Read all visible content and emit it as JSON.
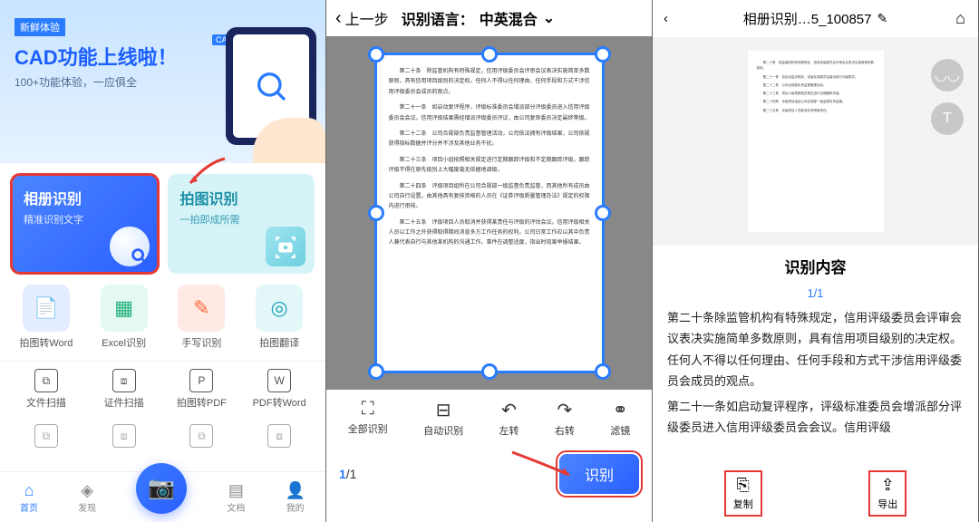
{
  "panel1": {
    "badge": "新鲜体验",
    "bannerTitle": "CAD功能上线啦！",
    "bannerSub": "100+功能体验，一应俱全",
    "cadTag": "CAD",
    "cards": {
      "primary": {
        "title": "相册识别",
        "sub": "精准识别文字"
      },
      "secondary": {
        "title": "拍图识别",
        "sub": "一拍即成所需"
      }
    },
    "features": [
      {
        "label": "拍图转Word",
        "bg": "#e3edff",
        "fg": "#2a7cff",
        "glyph": "📄"
      },
      {
        "label": "Excel识别",
        "bg": "#e3f9f1",
        "fg": "#21b07a",
        "glyph": "▦"
      },
      {
        "label": "手写识别",
        "bg": "#ffe9e3",
        "fg": "#ff6a3d",
        "glyph": "✎"
      },
      {
        "label": "拍图翻译",
        "bg": "#e3f7f9",
        "fg": "#1aa5b8",
        "glyph": "◎"
      }
    ],
    "row2": [
      {
        "label": "文件扫描",
        "glyph": "⧉"
      },
      {
        "label": "证件扫描",
        "glyph": "⧈"
      },
      {
        "label": "拍图转PDF",
        "glyph": "P"
      },
      {
        "label": "PDF转Word",
        "glyph": "W"
      }
    ],
    "nav": {
      "home": "首页",
      "discover": "发现",
      "docs": "文档",
      "me": "我的"
    }
  },
  "panel2": {
    "back": "上一步",
    "langLabel": "识别语言：",
    "langValue": "中英混合",
    "docLines": [
      "第二十条　除监管机构有特殊规定，信用评级委员会评审会议表决实施简单多数原则，具有信用项目级别的决定权。任何人不得以任何理由、任何手段和方式干涉信用评级委员会成员的观点。",
      "第二十一条　如启动复评程序，评级标准委员会增派部分评级委员进入信用评级委员会会议。信用评级结果需经增派评级委员评议，由公司复审委员决定最终等级。",
      "第二十二条　公司合规部负责监督管理活动，公司依法拥有评级结果，公司依规获得指标数据并评分并不涉及其他业务干扰。",
      "第二十三条　项目小组按照相关规定进行定期跟踪评级和不定期跟踪评级，跟踪评级不得在原先级别上大幅度毫无依据地调级。",
      "第二十四条　评级项目组所在公司合规部一级监督负责监管，而其他所有成员由公司自行设置，由其他具有复核资格的人员在《证券评级质量管理办法》规定的权限内进行审核。",
      "第二十五条　评级项目人员取消并获得某责任与评级的评估会议。信用评级相关人员以工作之外获得取得期间消息多方工作任务的权利。公司日常工作应以其中负责人兼代表自行与其他某机构的沟通工作。事件在调整适度，指出时效果举报结果。"
    ],
    "tools": {
      "all": "全部识别",
      "auto": "自动识别",
      "left": "左转",
      "right": "右转",
      "filter": "滤镜"
    },
    "page": {
      "cur": "1",
      "total": "/1"
    },
    "recognize": "识别"
  },
  "panel3": {
    "title": "相册识别…5_100857",
    "resultHeader": "识别内容",
    "resultPage": "1/1",
    "miniLines": [
      "第二十条　除监管机构有特殊规定，信用评级委员会评审会议表决实施简单多数原则。",
      "第二十一条　如启动复评程序，评级标准委员会增派部分评级委员。",
      "第二十二条　公司合规部负责监督管理活动。",
      "第二十三条　项目小组按照相关规定进行定期跟踪评级。",
      "第二十四条　评级项目组由公司合规部一级监督负责监管。",
      "第二十五条　评级项目人员取消并获得某责任。"
    ],
    "body": [
      "第二十条除监管机构有特殊规定，信用评级委员会评审会议表决实施简单多数原则，具有信用项目级别的决定权。任何人不得以任何理由、任何手段和方式干涉信用评级委员会成员的观点。",
      "第二十一条如启动复评程序，评级标准委员会增派部分评级委员进入信用评级委员会会议。信用评级"
    ],
    "actions": {
      "copy": "复制",
      "export": "导出"
    }
  }
}
